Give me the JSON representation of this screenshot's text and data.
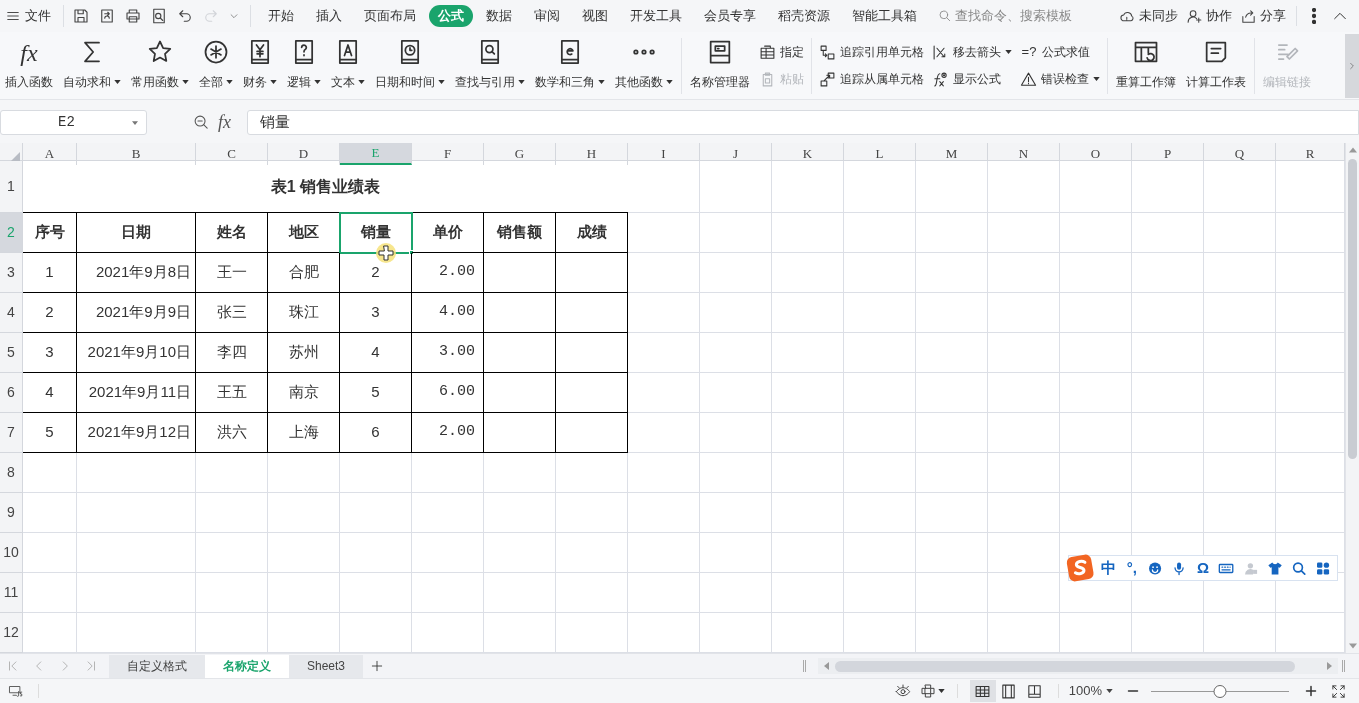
{
  "menu_bar": {
    "file": "文件",
    "quick_access": [
      {
        "disabled": false
      },
      {
        "disabled": false
      },
      {
        "disabled": false
      },
      {
        "disabled": false
      },
      {
        "disabled": false
      },
      {
        "disabled": true
      }
    ],
    "tabs": [
      {
        "label": "开始",
        "selected": false
      },
      {
        "label": "插入",
        "selected": false
      },
      {
        "label": "页面布局",
        "selected": false
      },
      {
        "label": "公式",
        "selected": true
      },
      {
        "label": "数据",
        "selected": false
      },
      {
        "label": "审阅",
        "selected": false
      },
      {
        "label": "视图",
        "selected": false
      },
      {
        "label": "开发工具",
        "selected": false
      },
      {
        "label": "会员专享",
        "selected": false
      },
      {
        "label": "稻壳资源",
        "selected": false
      },
      {
        "label": "智能工具箱",
        "selected": false
      }
    ],
    "search": {
      "placeholder": "查找命令、搜索模板"
    },
    "actions": [
      {
        "label": "未同步"
      },
      {
        "label": "协作"
      },
      {
        "label": "分享"
      }
    ]
  },
  "ribbon": {
    "groups": [
      {
        "items": [
          {
            "kind": "large",
            "label": "插入函数",
            "icon_text": "fx",
            "dropdown": false
          },
          {
            "kind": "large",
            "label": "自动求和",
            "dropdown": true
          },
          {
            "kind": "large",
            "label": "常用函数",
            "dropdown": true
          },
          {
            "kind": "large",
            "label": "全部",
            "dropdown": true
          },
          {
            "kind": "large",
            "label": "财务",
            "dropdown": true
          },
          {
            "kind": "large",
            "label": "逻辑",
            "dropdown": true
          },
          {
            "kind": "large",
            "label": "文本",
            "dropdown": true
          },
          {
            "kind": "large",
            "label": "日期和时间",
            "dropdown": true
          },
          {
            "kind": "large",
            "label": "查找与引用",
            "dropdown": true
          },
          {
            "kind": "large",
            "label": "数学和三角",
            "dropdown": true
          },
          {
            "kind": "large",
            "label": "其他函数",
            "dropdown": true
          }
        ]
      },
      {
        "items": [
          {
            "kind": "large",
            "label": "名称管理器",
            "dropdown": false
          },
          {
            "kind": "stack",
            "items": [
              {
                "label": "指定",
                "disabled": false,
                "dropdown": false
              },
              {
                "label": "粘贴",
                "disabled": true,
                "dropdown": false
              }
            ]
          }
        ]
      },
      {
        "items": [
          {
            "kind": "stack",
            "items": [
              {
                "label": "追踪引用单元格",
                "disabled": false,
                "dropdown": false
              },
              {
                "label": "追踪从属单元格",
                "disabled": false,
                "dropdown": false
              }
            ]
          },
          {
            "kind": "stack",
            "items": [
              {
                "label": "移去箭头",
                "disabled": false,
                "dropdown": true
              },
              {
                "label": "显示公式",
                "disabled": false,
                "dropdown": false
              }
            ]
          },
          {
            "kind": "stack",
            "items": [
              {
                "label": "公式求值",
                "icon_text": "=?",
                "disabled": false,
                "dropdown": false
              },
              {
                "label": "错误检查",
                "disabled": false,
                "dropdown": true
              }
            ]
          }
        ]
      },
      {
        "items": [
          {
            "kind": "large",
            "label": "重算工作簿",
            "dropdown": false
          },
          {
            "kind": "large",
            "label": "计算工作表",
            "dropdown": false
          }
        ]
      },
      {
        "items": [
          {
            "kind": "large",
            "label": "编辑链接",
            "dropdown": false,
            "disabled": true
          }
        ]
      }
    ]
  },
  "formula_bar": {
    "name_box": "E2",
    "fx": "fx",
    "value": "销量"
  },
  "sheet": {
    "columns": [
      {
        "label": "A",
        "selected": false
      },
      {
        "label": "B",
        "selected": false
      },
      {
        "label": "C",
        "selected": false
      },
      {
        "label": "D",
        "selected": false
      },
      {
        "label": "E",
        "selected": true
      },
      {
        "label": "F",
        "selected": false
      },
      {
        "label": "G",
        "selected": false
      },
      {
        "label": "H",
        "selected": false
      },
      {
        "label": "I",
        "selected": false
      },
      {
        "label": "J",
        "selected": false
      },
      {
        "label": "K",
        "selected": false
      },
      {
        "label": "L",
        "selected": false
      },
      {
        "label": "M",
        "selected": false
      },
      {
        "label": "N",
        "selected": false
      },
      {
        "label": "O",
        "selected": false
      },
      {
        "label": "P",
        "selected": false
      },
      {
        "label": "Q",
        "selected": false
      },
      {
        "label": "R",
        "selected": false
      }
    ],
    "rows": [
      {
        "label": "1",
        "selected": false,
        "kind": "title",
        "title": "表1 销售业绩表"
      },
      {
        "label": "2",
        "selected": true,
        "kind": "header",
        "cells": [
          "序号",
          "日期",
          "姓名",
          "地区",
          "销量",
          "单价",
          "销售额",
          "成绩"
        ]
      },
      {
        "label": "3",
        "selected": false,
        "kind": "data",
        "cells": [
          "1",
          "2021年9月8日",
          "王一",
          "合肥",
          "2",
          "2.00"
        ]
      },
      {
        "label": "4",
        "selected": false,
        "kind": "data",
        "cells": [
          "2",
          "2021年9月9日",
          "张三",
          "珠江",
          "3",
          "4.00"
        ]
      },
      {
        "label": "5",
        "selected": false,
        "kind": "data",
        "cells": [
          "3",
          "2021年9月10日",
          "李四",
          "苏州",
          "4",
          "3.00"
        ]
      },
      {
        "label": "6",
        "selected": false,
        "kind": "data",
        "cells": [
          "4",
          "2021年9月11日",
          "王五",
          "南京",
          "5",
          "6.00"
        ]
      },
      {
        "label": "7",
        "selected": false,
        "kind": "data",
        "cells": [
          "5",
          "2021年9月12日",
          "洪六",
          "上海",
          "6",
          "2.00"
        ]
      },
      {
        "label": "8",
        "selected": false
      },
      {
        "label": "9",
        "selected": false
      },
      {
        "label": "10",
        "selected": false
      },
      {
        "label": "11",
        "selected": false
      },
      {
        "label": "12",
        "selected": false
      }
    ]
  },
  "ime_toolbar": {
    "items": [
      {
        "kind": "logo"
      },
      {
        "kind": "text",
        "label": "中"
      },
      {
        "kind": "text",
        "label": "°,"
      },
      {
        "kind": "emoji"
      },
      {
        "kind": "mic"
      },
      {
        "kind": "text",
        "label": "Ω"
      },
      {
        "kind": "keyboard"
      },
      {
        "kind": "user",
        "disabled": true
      },
      {
        "kind": "shirt"
      },
      {
        "kind": "search"
      },
      {
        "kind": "apps"
      }
    ]
  },
  "sheet_tabs": [
    {
      "label": "自定义格式",
      "selected": false
    },
    {
      "label": "名称定义",
      "selected": true
    },
    {
      "label": "Sheet3",
      "selected": false
    }
  ],
  "status_bar": {
    "views": [
      {
        "selected": true
      },
      {
        "selected": false
      },
      {
        "selected": false
      }
    ],
    "zoom": "100%",
    "zoom_slider": {
      "level": 0.5
    }
  }
}
